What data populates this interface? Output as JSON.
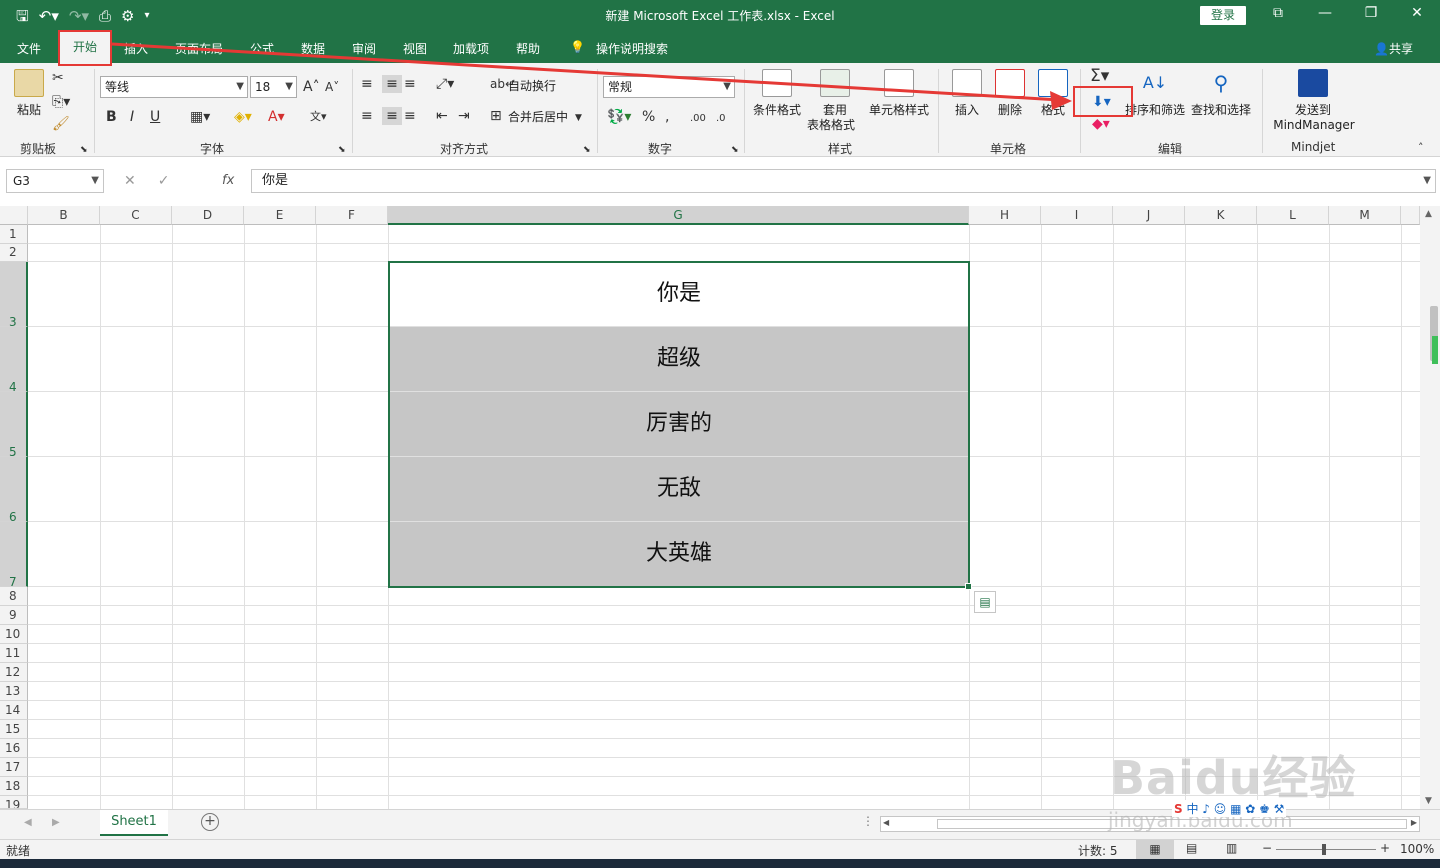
{
  "window": {
    "title": "新建 Microsoft Excel 工作表.xlsx  -  Excel",
    "login_label": "登录"
  },
  "tabs": [
    "文件",
    "开始",
    "插入",
    "页面布局",
    "公式",
    "数据",
    "审阅",
    "视图",
    "加载项",
    "帮助"
  ],
  "active_tab": "开始",
  "tell_me": "操作说明搜索",
  "share": "共享",
  "ribbon": {
    "clipboard": {
      "paste": "粘贴",
      "group": "剪贴板"
    },
    "font": {
      "name": "等线",
      "size": "18",
      "group": "字体",
      "bold": "B",
      "italic": "I",
      "underline": "U"
    },
    "alignment": {
      "wrap": "自动换行",
      "merge": "合并后居中",
      "group": "对齐方式"
    },
    "number": {
      "format": "常规",
      "group": "数字",
      "percent": "%"
    },
    "styles": {
      "conditional": "条件格式",
      "table_a": "套用",
      "table_b": "表格格式",
      "cell_styles": "单元格样式",
      "group": "样式"
    },
    "cells": {
      "insert": "插入",
      "delete": "删除",
      "format": "格式",
      "group": "单元格"
    },
    "editing": {
      "sort": "排序和筛选",
      "find": "查找和选择",
      "group": "编辑"
    },
    "mindjet": {
      "send_a": "发送到",
      "send_b": "MindManager",
      "group": "Mindjet"
    }
  },
  "formula_bar": {
    "name_box": "G3",
    "content": "你是"
  },
  "columns": [
    "B",
    "C",
    "D",
    "E",
    "F",
    "G",
    "H",
    "I",
    "J",
    "K",
    "L",
    "M"
  ],
  "selected_column": "G",
  "rows": [
    "1",
    "2",
    "3",
    "4",
    "5",
    "6",
    "7",
    "8",
    "9",
    "10",
    "11",
    "12",
    "13",
    "14",
    "15",
    "16",
    "17",
    "18",
    "19"
  ],
  "cells": [
    "你是",
    "超级",
    "厉害的",
    "无敌",
    "大英雄"
  ],
  "sheet": {
    "name": "Sheet1"
  },
  "status": {
    "ready": "就绪",
    "count": "计数: 5",
    "zoom": "100%"
  },
  "watermark": {
    "main": "Baidu经验",
    "sub": "jingyan.baidu.com"
  },
  "colors": {
    "excel_green": "#217346",
    "highlight_red": "#e53935"
  }
}
